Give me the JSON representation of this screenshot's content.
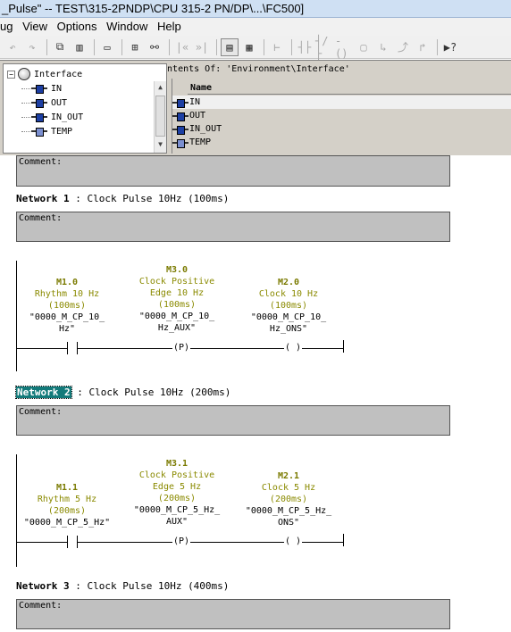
{
  "window": {
    "title": "_Pulse\" -- TEST\\315-2PNDP\\CPU 315-2 PN/DP\\...\\FC500]"
  },
  "menu": [
    "ug",
    "View",
    "Options",
    "Window",
    "Help"
  ],
  "toolbar": {
    "icons": [
      "undo-icon",
      "redo-icon",
      "compare-icon",
      "monitor-icon",
      "overview-icon",
      "network-icon",
      "glasses-icon",
      "first-icon",
      "last-icon",
      "window-icon",
      "detail-icon",
      "branch-icon",
      "no-contact-icon",
      "nc-contact-icon",
      "coil-icon",
      "box-icon",
      "open-branch-icon",
      "close-branch-icon",
      "jump-icon",
      "help-icon"
    ]
  },
  "interface": {
    "contents_label": "Contents Of: 'Environment\\Interface'",
    "tree": {
      "root": "Interface",
      "items": [
        "IN",
        "OUT",
        "IN_OUT",
        "TEMP"
      ]
    },
    "table": {
      "header": "Name",
      "rows": [
        "IN",
        "OUT",
        "IN_OUT",
        "TEMP"
      ]
    }
  },
  "editor": {
    "top_comment": "Comment:",
    "networks": [
      {
        "label": "Network 1",
        "title": ": Clock Pulse 10Hz (100ms)",
        "comment": "Comment:",
        "contact": {
          "addr": "M1.0",
          "desc": [
            "Rhythm 10 Hz",
            "(100ms)"
          ],
          "symbol": [
            "\"0000_M_CP_10_",
            "Hz\""
          ]
        },
        "edge": {
          "addr": "M3.0",
          "desc": [
            "Clock Positive",
            "Edge 10 Hz",
            "(100ms)"
          ],
          "symbol": [
            "\"0000_M_CP_10_",
            "Hz_AUX\""
          ],
          "coil": "(P)"
        },
        "coil": {
          "addr": "M2.0",
          "desc": [
            "Clock 10 Hz",
            "(100ms)"
          ],
          "symbol": [
            "\"0000_M_CP_10_",
            "Hz_ONS\""
          ],
          "coil": "( )"
        }
      },
      {
        "label": "Network 2",
        "title": ": Clock Pulse 10Hz (200ms)",
        "comment": "Comment:",
        "contact": {
          "addr": "M1.1",
          "desc": [
            "Rhythm 5 Hz",
            "(200ms)"
          ],
          "symbol": [
            "\"0000_M_CP_5_Hz\""
          ]
        },
        "edge": {
          "addr": "M3.1",
          "desc": [
            "Clock Positive",
            "Edge 5 Hz",
            "(200ms)"
          ],
          "symbol": [
            "\"0000_M_CP_5_Hz_",
            "AUX\""
          ],
          "coil": "(P)"
        },
        "coil": {
          "addr": "M2.1",
          "desc": [
            "Clock 5 Hz",
            "(200ms)"
          ],
          "symbol": [
            "\"0000_M_CP_5_Hz_",
            "ONS\""
          ],
          "coil": "( )"
        }
      },
      {
        "label": "Network 3",
        "title": ": Clock Pulse 10Hz (400ms)",
        "comment": "Comment:"
      }
    ]
  }
}
